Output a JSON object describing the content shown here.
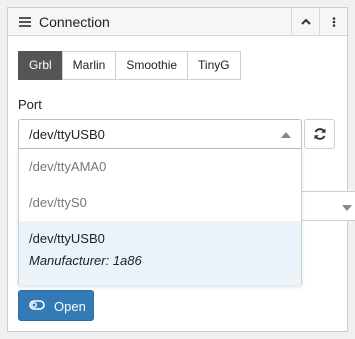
{
  "widget": {
    "title": "Connection",
    "icons": {
      "menu": "hamburger-icon",
      "collapse": "chevron-up-icon",
      "more": "vertical-ellipsis-icon"
    }
  },
  "controllers": {
    "tabs": [
      {
        "label": "Grbl",
        "active": true
      },
      {
        "label": "Marlin",
        "active": false
      },
      {
        "label": "Smoothie",
        "active": false
      },
      {
        "label": "TinyG",
        "active": false
      }
    ]
  },
  "port": {
    "label": "Port",
    "selected": "/dev/ttyUSB0",
    "refresh_icon": "refresh-icon",
    "options": [
      {
        "name": "/dev/ttyAMA0"
      },
      {
        "name": "/dev/ttyS0"
      },
      {
        "name": "/dev/ttyUSB0",
        "manufacturer": "Manufacturer: 1a86",
        "highlighted": true
      }
    ]
  },
  "actions": {
    "open_label": "Open",
    "open_icon": "toggle-off-icon"
  },
  "colors": {
    "active_tab": "#555555",
    "primary_button": "#337ab7",
    "highlight_row": "#eaf2fa"
  }
}
